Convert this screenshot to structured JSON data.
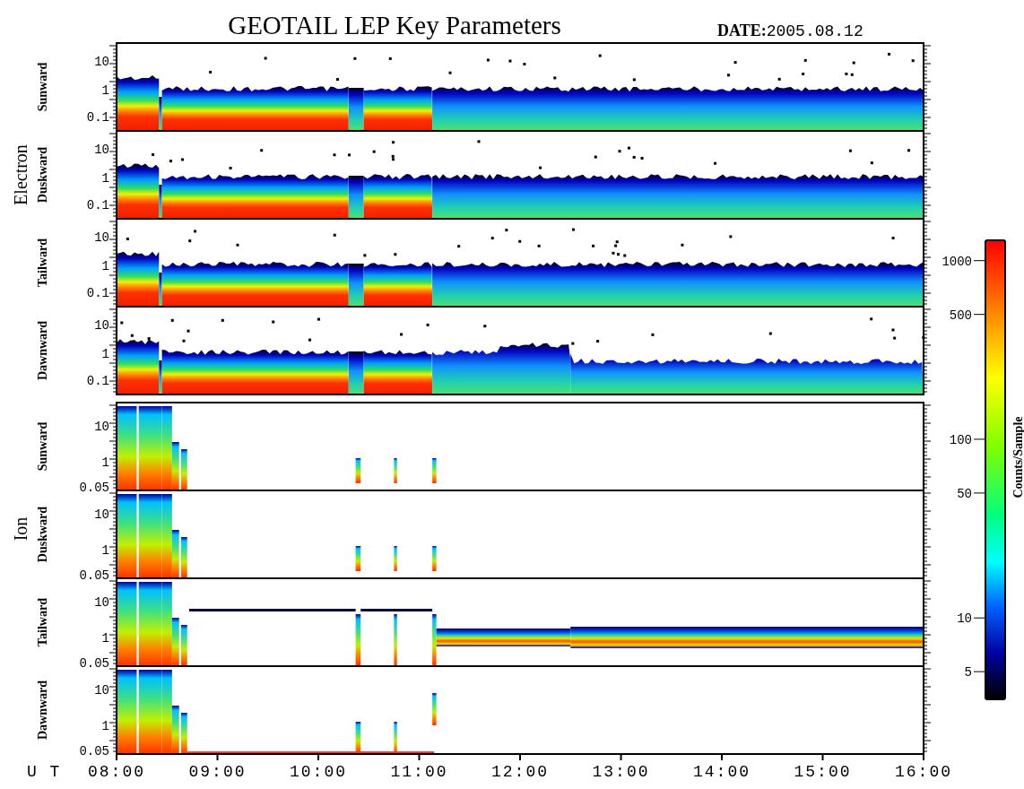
{
  "title": "GEOTAIL LEP Key Parameters",
  "date_label": "DATE:",
  "date": "2005.08.12",
  "groups": [
    {
      "name": "Electron",
      "kind": "electron",
      "panels": [
        {
          "label": "Sunward",
          "yticks": [
            "10",
            "1",
            "0.1"
          ]
        },
        {
          "label": "Duskward",
          "yticks": [
            "10",
            "1",
            "0.1"
          ]
        },
        {
          "label": "Tailward",
          "yticks": [
            "10",
            "1",
            "0.1"
          ]
        },
        {
          "label": "Dawnward",
          "yticks": [
            "10",
            "1",
            "0.1"
          ]
        }
      ]
    },
    {
      "name": "Ion",
      "kind": "ion",
      "panels": [
        {
          "label": "Sunward",
          "yticks": [
            "10",
            "1",
            "0.05"
          ]
        },
        {
          "label": "Duskward",
          "yticks": [
            "10",
            "1",
            "0.05"
          ]
        },
        {
          "label": "Tailward",
          "yticks": [
            "10",
            "1",
            "0.05"
          ]
        },
        {
          "label": "Dawnward",
          "yticks": [
            "10",
            "1",
            "0.05"
          ]
        }
      ]
    }
  ],
  "x_axis": {
    "prefix": "U T",
    "ticks": [
      "08:00",
      "09:00",
      "10:00",
      "11:00",
      "12:00",
      "13:00",
      "14:00",
      "15:00",
      "16:00"
    ]
  },
  "colorbar": {
    "title": "Counts/Sample",
    "ticks": [
      "1000",
      "500",
      "100",
      "50",
      "10",
      "5"
    ]
  }
}
